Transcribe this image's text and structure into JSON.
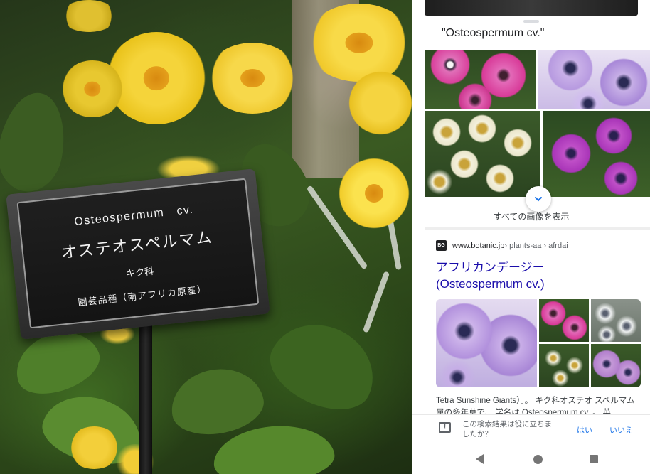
{
  "photo": {
    "sign": {
      "latin_name": "Osteospermum　cv.",
      "japanese_name": "オステオスペルマム",
      "family": "キク科",
      "origin": "園芸品種（南アフリカ原産）"
    }
  },
  "lens_panel": {
    "query": "\"Osteospermum cv.\"",
    "show_all_images": "すべての画像を表示",
    "result": {
      "favicon_text": "BG",
      "domain": "www.botanic.jp",
      "path": " › plants-aa › afrdai",
      "title_line1": "アフリカンデージー",
      "title_line2": "(Osteospermum cv.)",
      "snippet": "Tetra Sunshine Giants）」。 キク科オステオ スペルマム属の多年草で、 学名は Osteospermum cv. 。 英"
    },
    "feedback": {
      "question": "この検索結果は役に立ちましたか？",
      "yes": "はい",
      "no": "いいえ"
    },
    "icons": {
      "expand": "chevron-down-icon",
      "feedback": "feedback-icon",
      "back": "back-icon",
      "home": "home-icon",
      "recents": "recents-icon"
    }
  },
  "colors": {
    "link": "#1a0dab",
    "accent": "#1a73e8",
    "pink_flower": "#d9409c",
    "purple_flower": "#b38ad6",
    "yellow_flower": "#f2c31b"
  }
}
